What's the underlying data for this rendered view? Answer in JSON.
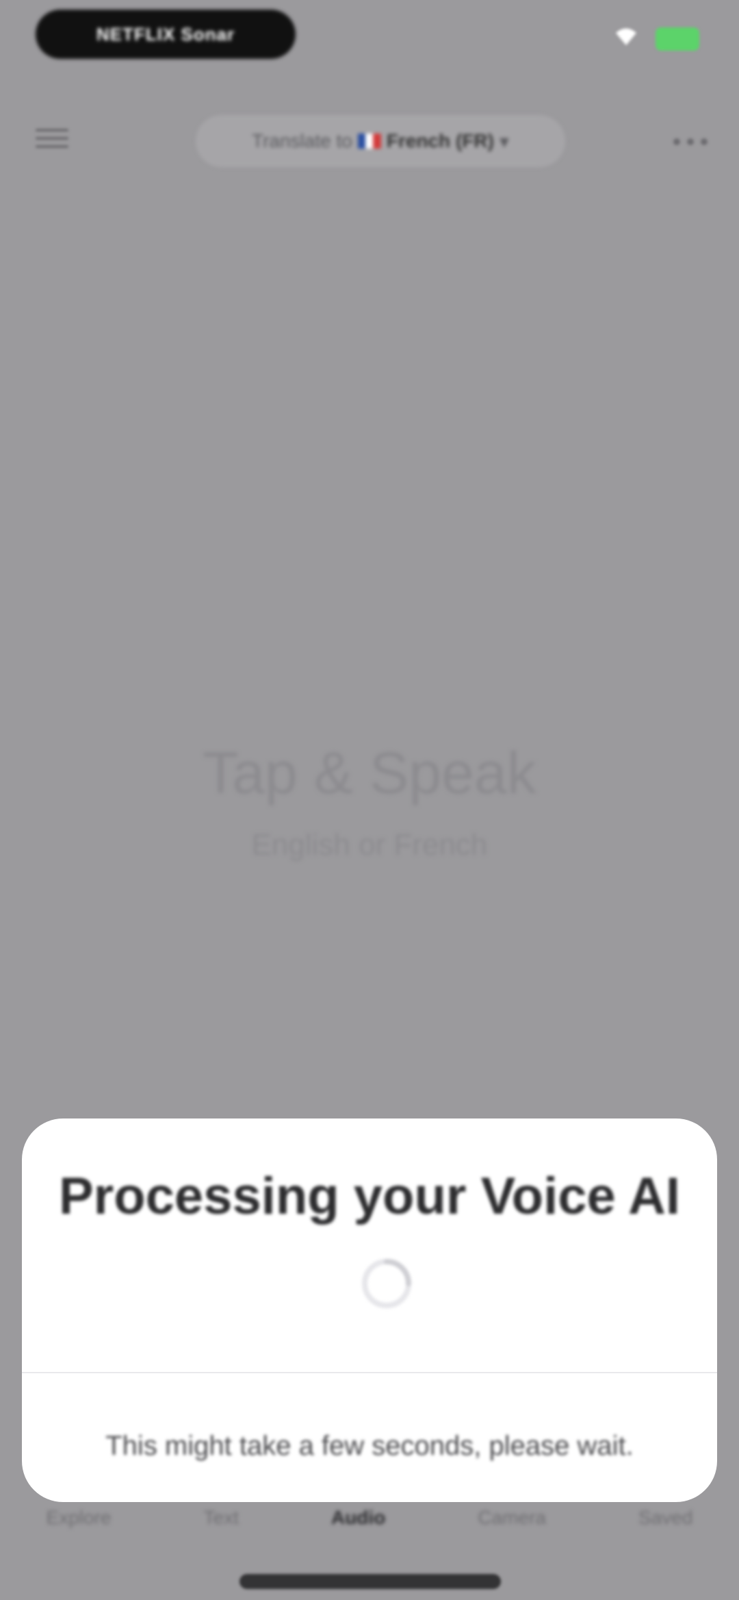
{
  "status_bar": {
    "carrier_label": "NETFLIX Sonar",
    "colors": {
      "battery": "#5cd36a"
    },
    "icons": [
      "wifi-icon",
      "battery-icon"
    ]
  },
  "header": {
    "translate_prefix": "Translate to",
    "language_label": "French (FR)",
    "icons": [
      "menu-icon",
      "chevron-down-icon",
      "more-icon"
    ]
  },
  "main": {
    "prompt_title": "Tap & Speak",
    "prompt_subtitle": "English or French"
  },
  "tabs": [
    {
      "label": "Explore",
      "active": false
    },
    {
      "label": "Text",
      "active": false
    },
    {
      "label": "Audio",
      "active": true
    },
    {
      "label": "Camera",
      "active": false
    },
    {
      "label": "Saved",
      "active": false
    }
  ],
  "dialog": {
    "title": "Processing your Voice AI",
    "message": "This might take a few seconds, please wait."
  }
}
